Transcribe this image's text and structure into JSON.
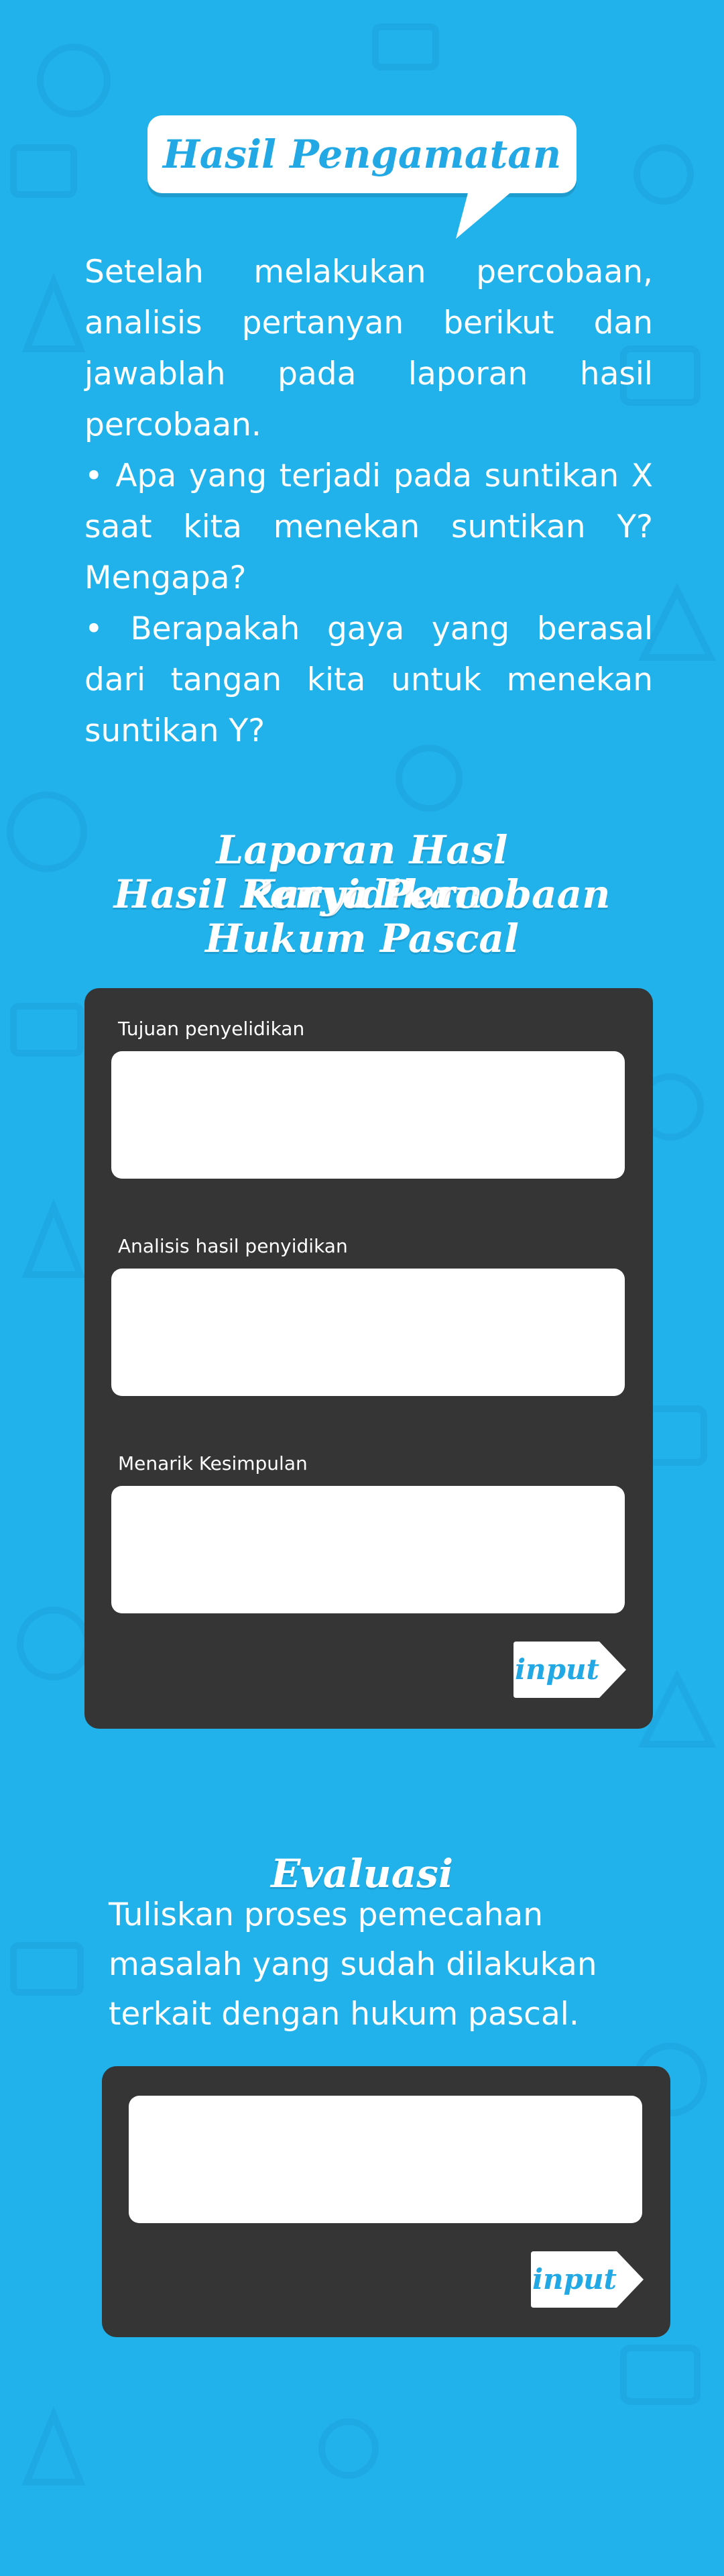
{
  "header": {
    "title": "Hasil Pengamatan"
  },
  "intro": {
    "paragraph": "Setelah melakukan percobaan, analisis pertanyan berikut dan jawablah pada laporan hasil percobaan.",
    "question_1": "• Apa yang terjadi pada suntikan X saat kita menekan suntikan Y? Mengapa?",
    "question_2": "• Berapakah gaya yang berasal dari tangan kita untuk menekan suntikan Y?"
  },
  "report": {
    "title_line_1": "Laporan Hasl Penyidikan",
    "title_line_2": "Hasil Karya Percobaan",
    "title_line_3": "Hukum Pascal",
    "fields": [
      {
        "label": "Tujuan penyelidikan",
        "value": ""
      },
      {
        "label": "Analisis hasil penyidikan",
        "value": ""
      },
      {
        "label": "Menarik Kesimpulan",
        "value": ""
      }
    ],
    "submit_label": "input"
  },
  "evaluation": {
    "title": "Evaluasi",
    "prompt": "Tuliskan proses pemecahan masalah yang sudah dilakukan terkait dengan hukum pascal.",
    "answer_value": "",
    "submit_label": "input"
  },
  "colors": {
    "background": "#21b2ec",
    "panel": "#353535",
    "accent_text": "#22a8e4",
    "white": "#ffffff"
  }
}
